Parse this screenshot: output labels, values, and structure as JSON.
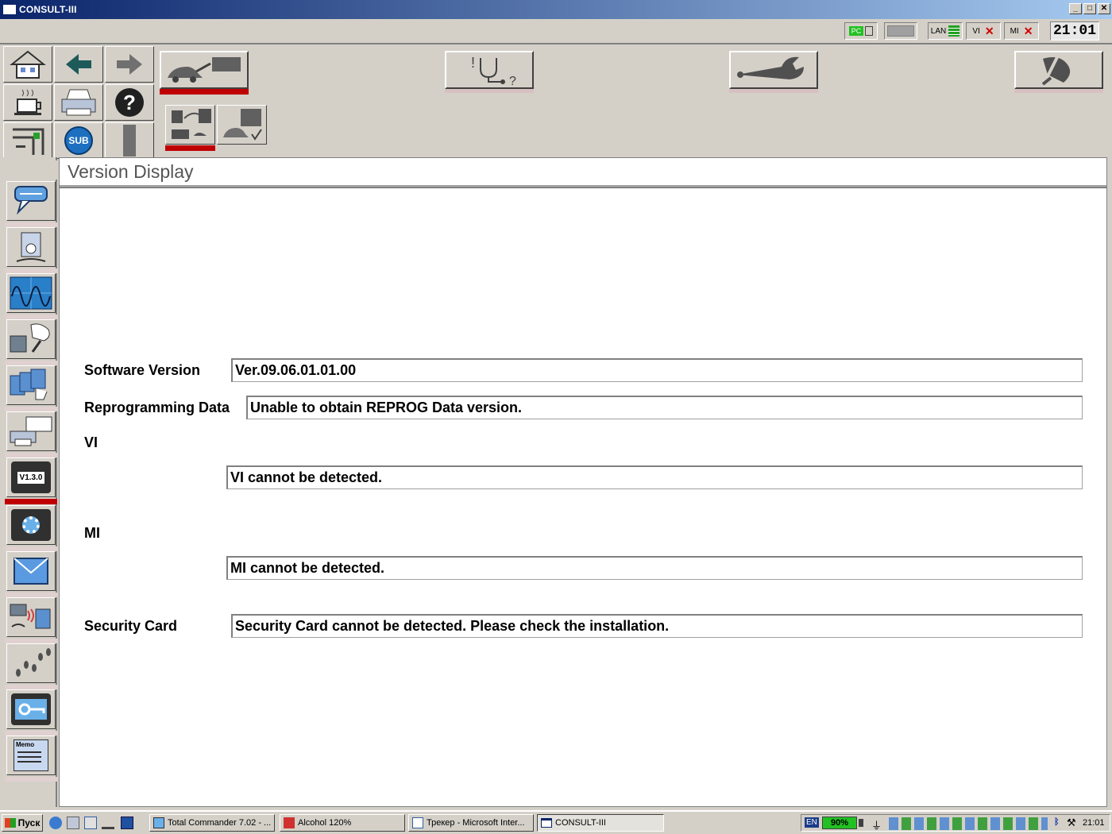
{
  "window": {
    "title": "CONSULT-III",
    "minimize": "_",
    "maximize": "□",
    "close": "✕"
  },
  "status": {
    "pc_label": "PC",
    "lan_label": "LAN",
    "vi_label": "VI",
    "mi_label": "MI",
    "clock": "21:01"
  },
  "toolbar": {
    "sub_label": "SUB",
    "help_label": "?"
  },
  "nav": {
    "version_badge": "V1.3.0",
    "memo_label": "Memo"
  },
  "page": {
    "title": "Version Display",
    "software_version_label": "Software Version",
    "software_version_value": "Ver.09.06.01.01.00",
    "reprog_label": "Reprogramming Data",
    "reprog_value": "Unable to obtain REPROG Data version.",
    "vi_label": "VI",
    "vi_value": "VI cannot be detected.",
    "mi_label": "MI",
    "mi_value": "MI cannot be detected.",
    "security_label": "Security Card",
    "security_value": "Security Card cannot be detected. Please check the installation."
  },
  "taskbar": {
    "start_label": "Пуск",
    "tasks": [
      {
        "label": "Total Commander 7.02 - ..."
      },
      {
        "label": "Alcohol 120%"
      },
      {
        "label": "Трекер - Microsoft Inter..."
      },
      {
        "label": "CONSULT-III"
      }
    ],
    "lang": "EN",
    "battery": "90%",
    "time": "21:01"
  },
  "colors": {
    "accent_red": "#c00000",
    "title_blue": "#0a246a",
    "battery_green": "#22c022"
  }
}
